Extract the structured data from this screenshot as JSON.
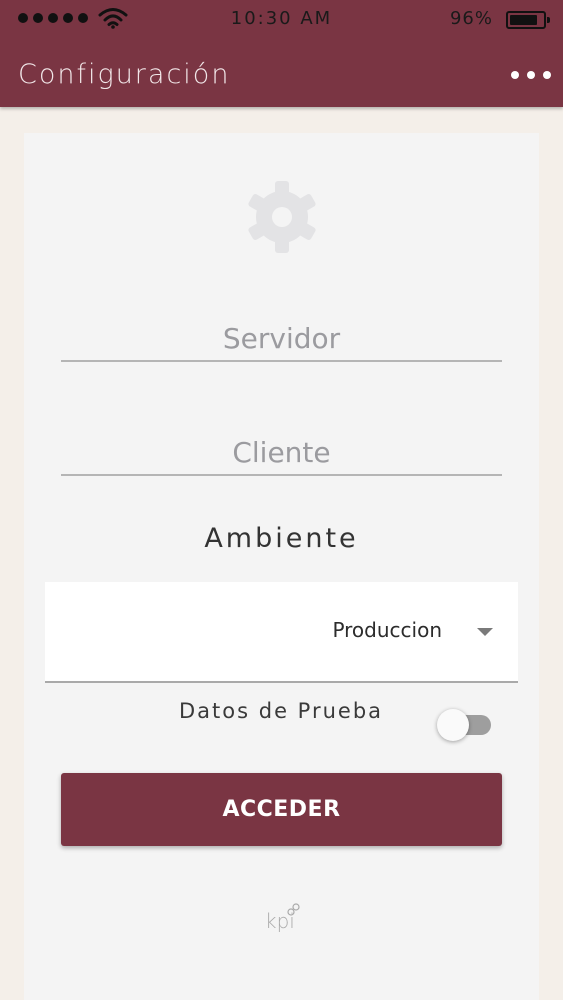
{
  "status_bar": {
    "time": "10:30 AM",
    "battery_percent": "96%",
    "battery_level": 0.96,
    "signal_icon": "signal-dots-icon",
    "wifi_icon": "wifi-icon"
  },
  "header": {
    "title": "Configuración",
    "menu_icon": "more-horizontal-icon",
    "color": "#7a3543"
  },
  "form": {
    "settings_icon": "gear-icon",
    "servidor_placeholder": "Servidor",
    "servidor_value": "",
    "cliente_placeholder": "Cliente",
    "cliente_value": "",
    "ambiente_label": "Ambiente",
    "ambiente_selected": "Produccion",
    "datos_prueba_label": "Datos de Prueba",
    "datos_prueba_on": false,
    "submit_label": "ACCEDER"
  },
  "footer": {
    "logo_text": "kpi"
  }
}
